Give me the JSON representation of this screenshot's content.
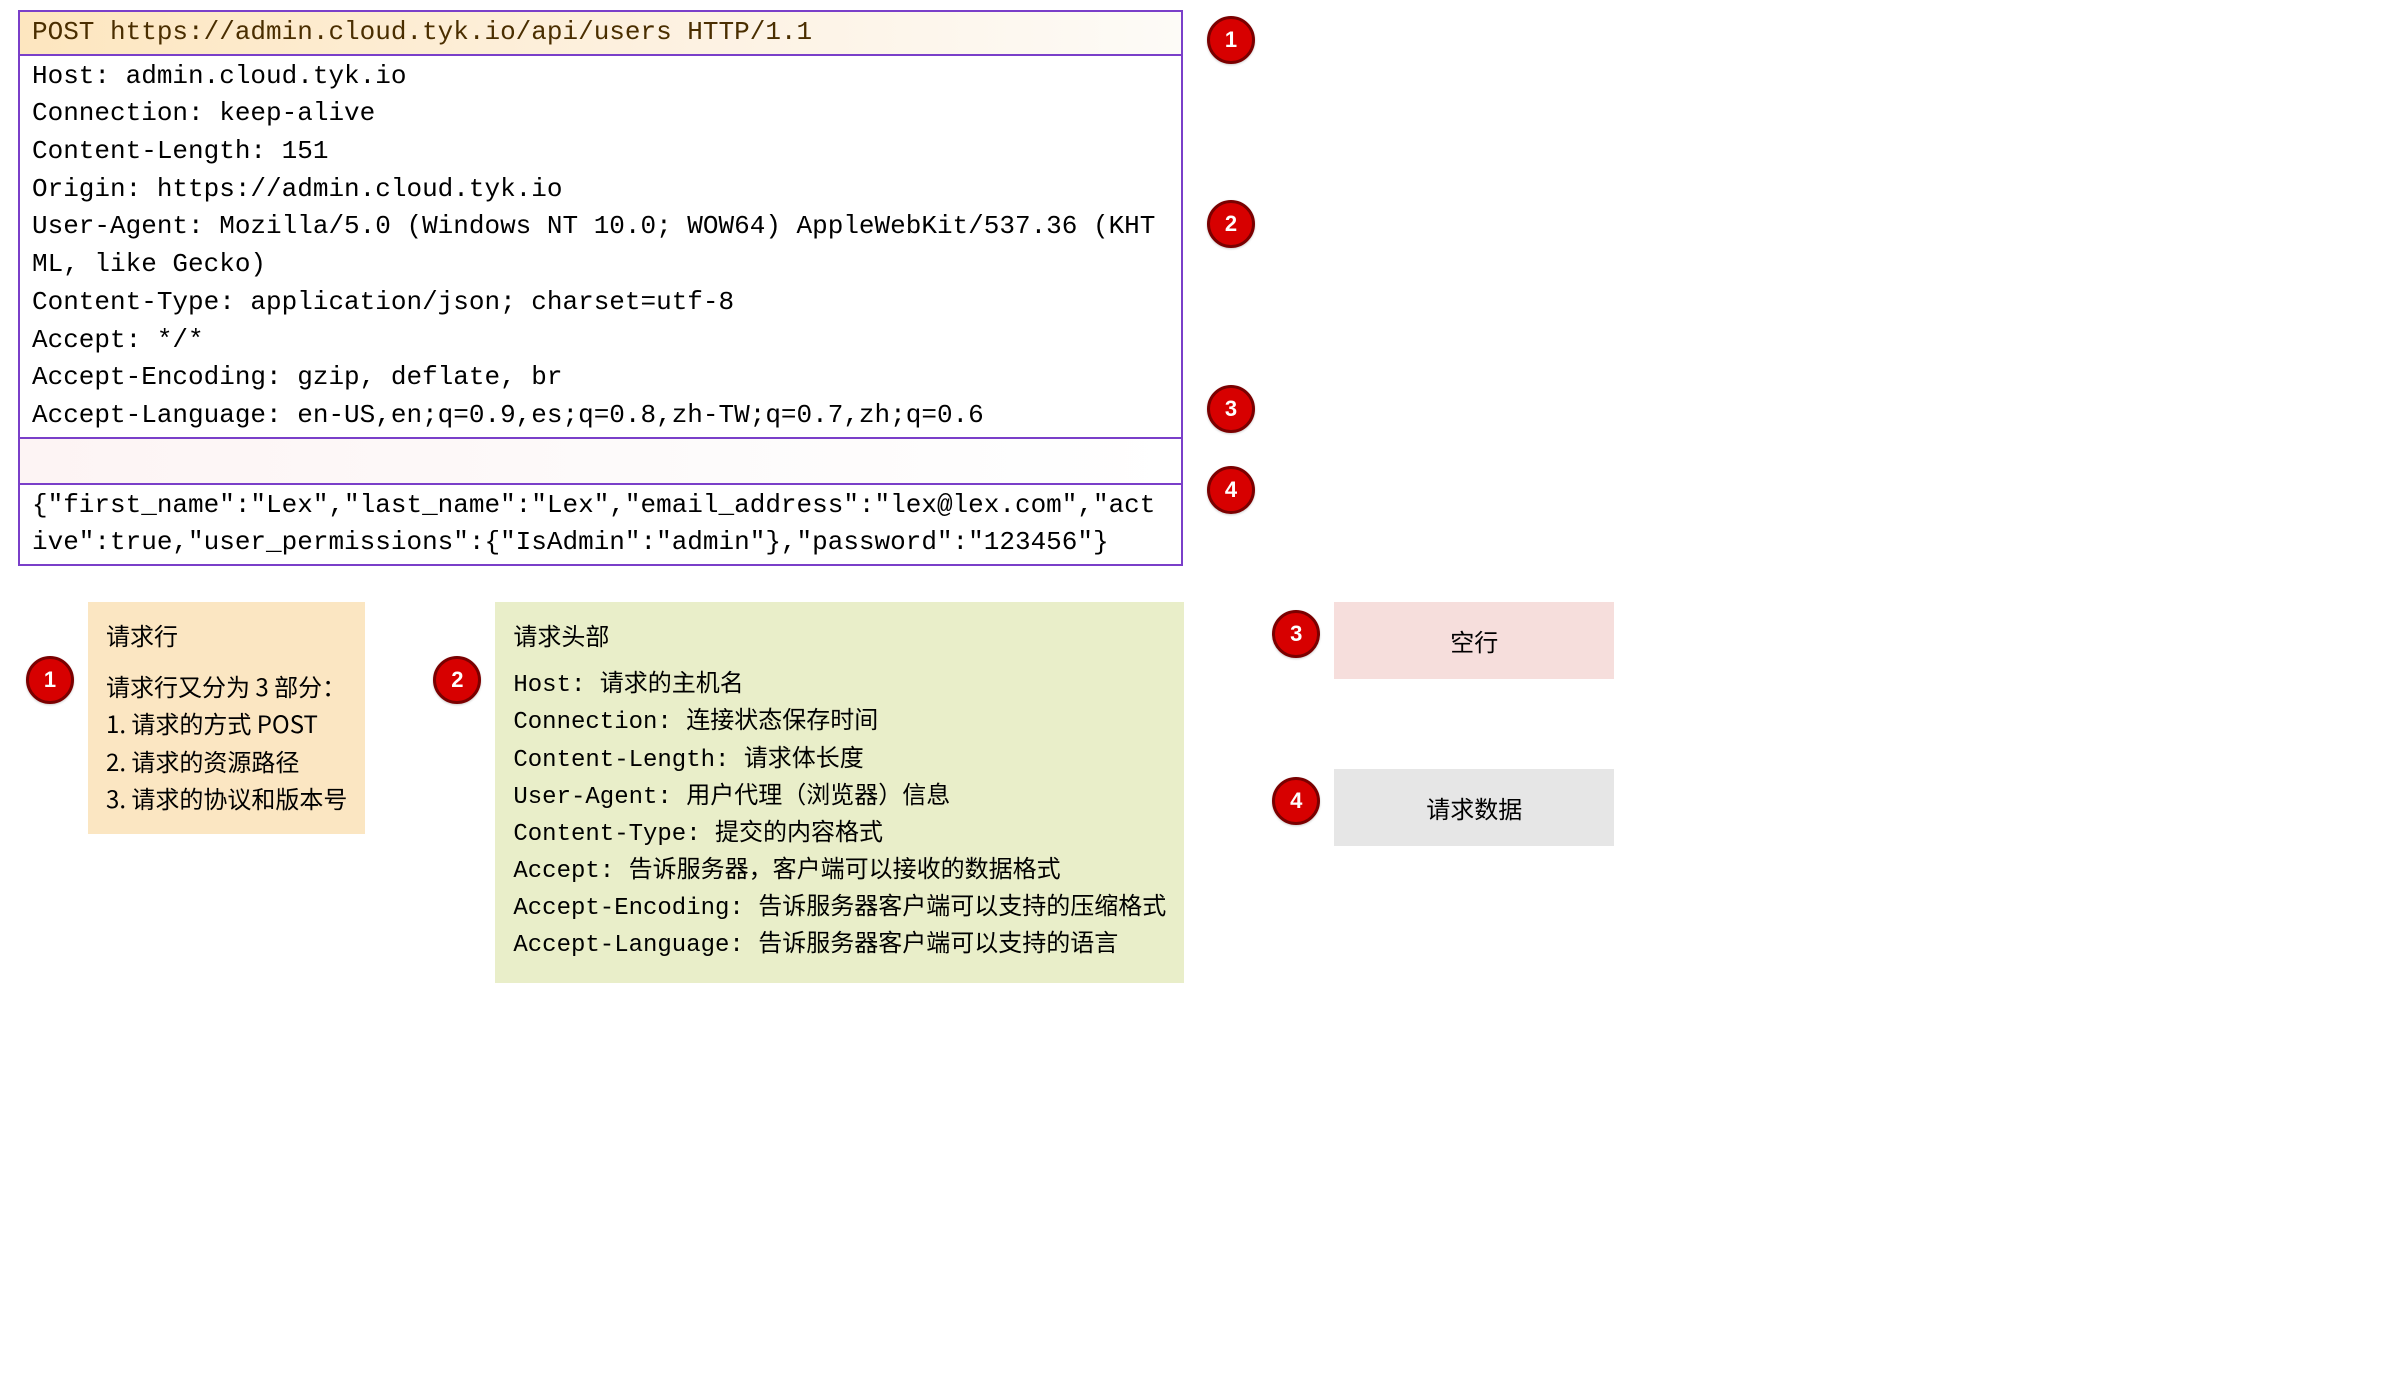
{
  "request": {
    "request_line": "POST https://admin.cloud.tyk.io/api/users HTTP/1.1",
    "headers_text": "Host: admin.cloud.tyk.io\nConnection: keep-alive\nContent-Length: 151\nOrigin: https://admin.cloud.tyk.io\nUser-Agent: Mozilla/5.0 (Windows NT 10.0; WOW64) AppleWebKit/537.36 (KHTML, like Gecko)\nContent-Type: application/json; charset=utf-8\nAccept: */*\nAccept-Encoding: gzip, deflate, br\nAccept-Language: en-US,en;q=0.9,es;q=0.8,zh-TW;q=0.7,zh;q=0.6",
    "blank_line": " ",
    "body": "{\"first_name\":\"Lex\",\"last_name\":\"Lex\",\"email_address\":\"lex@lex.com\",\"active\":true,\"user_permissions\":{\"IsAdmin\":\"admin\"},\"password\":\"123456\"}"
  },
  "badges": {
    "b1": "1",
    "b2": "2",
    "b3": "3",
    "b4": "4"
  },
  "legend": {
    "item1": {
      "title": "请求行",
      "body": "请求行又分为 3 部分：\n1. 请求的方式 POST\n2. 请求的资源路径\n3. 请求的协议和版本号"
    },
    "item2": {
      "title": "请求头部",
      "body": "Host: 请求的主机名\nConnection: 连接状态保存时间\nContent-Length: 请求体长度\nUser-Agent: 用户代理（浏览器）信息\nContent-Type: 提交的内容格式\nAccept: 告诉服务器，客户端可以接收的数据格式\nAccept-Encoding: 告诉服务器客户端可以支持的压缩格式\nAccept-Language: 告诉服务器客户端可以支持的语言"
    },
    "item3": {
      "title": "空行"
    },
    "item4": {
      "title": "请求数据"
    }
  }
}
